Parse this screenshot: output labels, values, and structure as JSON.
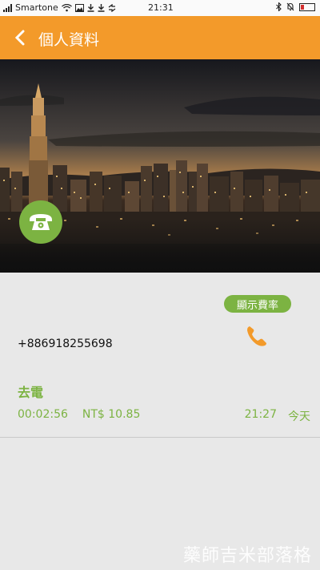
{
  "status_bar": {
    "carrier": "Smartone",
    "time": "21:31"
  },
  "header": {
    "title": "個人資料"
  },
  "contact": {
    "phone_number": "+886918255698",
    "rate_button_label": "顯示費率"
  },
  "call_log": {
    "type": "去電",
    "duration": "00:02:56",
    "cost": "NT$ 10.85",
    "time": "21:27",
    "day": "今天"
  },
  "watermark": "藥師吉米部落格",
  "colors": {
    "accent_orange": "#f39a2a",
    "accent_green": "#7cb342"
  }
}
